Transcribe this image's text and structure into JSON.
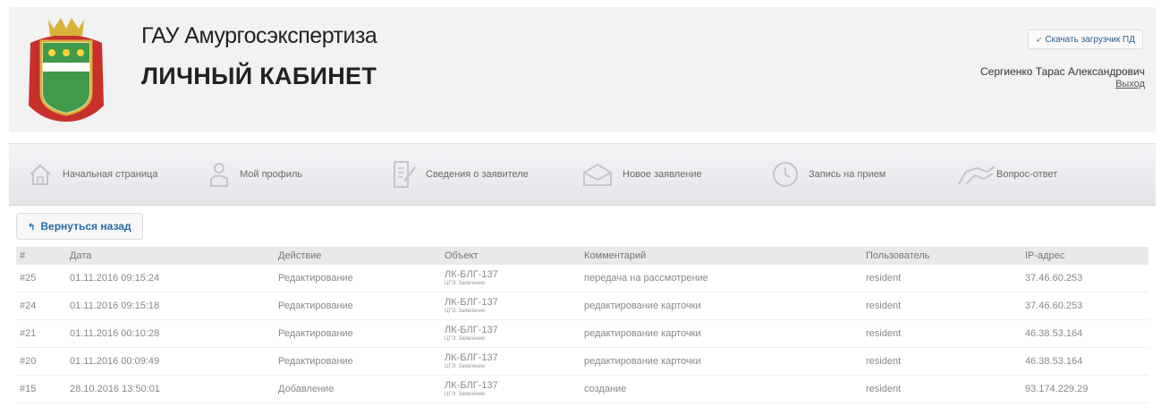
{
  "header": {
    "org_name": "ГАУ Амургосэкспертиза",
    "cabinet_title": "ЛИЧНЫЙ КАБИНЕТ",
    "download_label": "Скачать загрузчик ПД",
    "user_name": "Сергиенко Тарас Александрович",
    "logout_label": "Выход"
  },
  "nav": [
    {
      "label": "Начальная страница",
      "icon": "home-icon"
    },
    {
      "label": "Мой профиль",
      "icon": "profile-icon"
    },
    {
      "label": "Сведения о заявителе",
      "icon": "document-edit-icon"
    },
    {
      "label": "Новое заявление",
      "icon": "envelope-icon"
    },
    {
      "label": "Запись на прием",
      "icon": "clock-icon"
    },
    {
      "label": "Вопрос-ответ",
      "icon": "handshake-icon"
    }
  ],
  "back_label": "Вернуться назад",
  "table": {
    "headers": [
      "#",
      "Дата",
      "Действие",
      "Объект",
      "Комментарий",
      "Пользователь",
      "IP-адрес"
    ],
    "rows": [
      {
        "id": "#25",
        "date": "01.11.2016 09:15:24",
        "action": "Редактирование",
        "object": "ЛК-БЛГ-137",
        "object_sub": "ЦГЭ: Заявление",
        "comment": "передача на рассмотрение",
        "user": "resident",
        "ip": "37.46.60.253"
      },
      {
        "id": "#24",
        "date": "01.11.2016 09:15:18",
        "action": "Редактирование",
        "object": "ЛК-БЛГ-137",
        "object_sub": "ЦГЭ: Заявление",
        "comment": "редактирование карточки",
        "user": "resident",
        "ip": "37.46.60.253"
      },
      {
        "id": "#21",
        "date": "01.11.2016 00:10:28",
        "action": "Редактирование",
        "object": "ЛК-БЛГ-137",
        "object_sub": "ЦГЭ: Заявление",
        "comment": "редактирование карточки",
        "user": "resident",
        "ip": "46.38.53.164"
      },
      {
        "id": "#20",
        "date": "01.11.2016 00:09:49",
        "action": "Редактирование",
        "object": "ЛК-БЛГ-137",
        "object_sub": "ЦГЭ: Заявление",
        "comment": "редактирование карточки",
        "user": "resident",
        "ip": "46.38.53.164"
      },
      {
        "id": "#15",
        "date": "28.10.2016 13:50:01",
        "action": "Добавление",
        "object": "ЛК-БЛГ-137",
        "object_sub": "ЦГЭ: Заявление",
        "comment": "создание",
        "user": "resident",
        "ip": "93.174.229.29"
      }
    ]
  },
  "colors": {
    "link": "#2b6aa6",
    "header_bg": "#f2f2f2",
    "logo_green": "#3f9a4c",
    "logo_red": "#c8302b",
    "logo_gold": "#d8b23a"
  }
}
